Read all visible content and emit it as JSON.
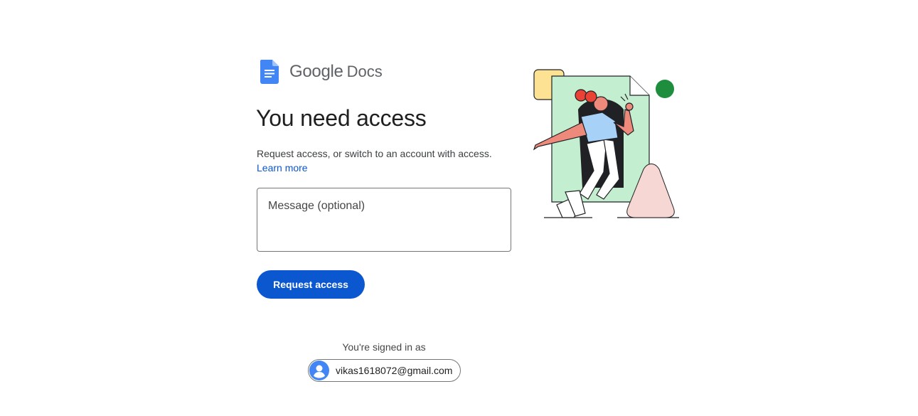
{
  "logo": {
    "google_text": "Google",
    "product_text": "Docs",
    "icon": "google-docs-icon"
  },
  "main": {
    "title": "You need access",
    "description": "Request access, or switch to an account with access.",
    "learn_more": "Learn more",
    "message_placeholder": "Message (optional)",
    "request_button": "Request access"
  },
  "account": {
    "signed_in_label": "You're signed in as",
    "email": "vikas1618072@gmail.com",
    "avatar_icon": "account-avatar-icon"
  },
  "colors": {
    "primary": "#0b57d0",
    "docs_blue": "#4285f4"
  }
}
